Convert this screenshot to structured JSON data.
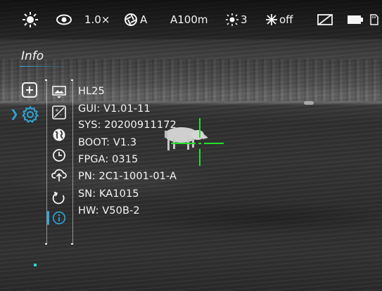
{
  "status_bar": {
    "zoom": "1.0×",
    "calibration_mode": "A",
    "rangefinder": "A100m",
    "brightness_level": "3",
    "wifi_state": "off",
    "icons": [
      "brightness-sun-icon",
      "eye-icon",
      "aperture-icon",
      "sun-icon",
      "wifi-star-icon",
      "picture-in-picture-off-icon",
      "battery-icon",
      "sd-card-icon"
    ]
  },
  "menu": {
    "title": "Info",
    "left_items": [
      {
        "name": "add",
        "icon": "plus-box-icon"
      },
      {
        "name": "settings",
        "icon": "gear-icon",
        "selected": true
      }
    ],
    "submenu_icons": [
      "image-icon",
      "contrast-icon",
      "globe-icon",
      "clock-icon",
      "cloud-upload-icon",
      "restore-icon",
      "info-icon"
    ],
    "selected_submenu": "info",
    "accent_color": "#2fa6d8"
  },
  "info": {
    "model": "HL25",
    "gui": "GUI: V1.01-11",
    "sys": "SYS: 20200911172",
    "boot": "BOOT: V1.3",
    "fpga": "FPGA: 0315",
    "pn": "PN: 2C1-1001-01-A",
    "sn": "SN: KA1015",
    "hw": "HW: V50B-2"
  },
  "reticle": {
    "color": "#22e02a"
  }
}
